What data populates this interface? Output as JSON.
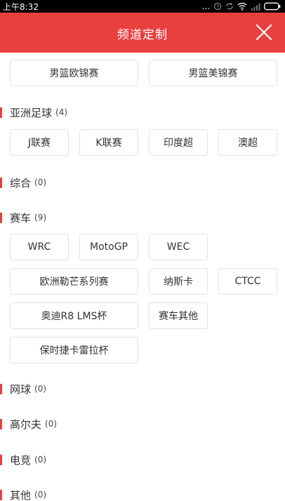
{
  "status_bar": {
    "time": "上午8:32",
    "dots": "...",
    "battery_icon": "battery-icon",
    "wifi_icon": "wifi-icon",
    "signal_icon": "signal-icon"
  },
  "header": {
    "title": "频道定制",
    "close_icon": "close-icon"
  },
  "accent_color": "#e8403f",
  "basketball_chips": [
    "男篮欧锦赛",
    "男篮美锦赛"
  ],
  "categories": [
    {
      "name": "亚洲足球",
      "count": "(4)",
      "chips": [
        "J联赛",
        "K联赛",
        "印度超",
        "澳超"
      ]
    },
    {
      "name": "综合",
      "count": "(0)",
      "chips": []
    },
    {
      "name": "赛车",
      "count": "(9)",
      "chips": [
        "WRC",
        "MotoGP",
        "WEC",
        "欧洲勒芒系列赛",
        "纳斯卡",
        "CTCC",
        "奥迪R8 LMS杯",
        "赛车其他",
        "保时捷卡雷拉杯"
      ]
    },
    {
      "name": "网球",
      "count": "(0)",
      "chips": []
    },
    {
      "name": "高尔夫",
      "count": "(0)",
      "chips": []
    },
    {
      "name": "电竞",
      "count": "(0)",
      "chips": []
    },
    {
      "name": "其他",
      "count": "(0)",
      "chips": []
    }
  ]
}
